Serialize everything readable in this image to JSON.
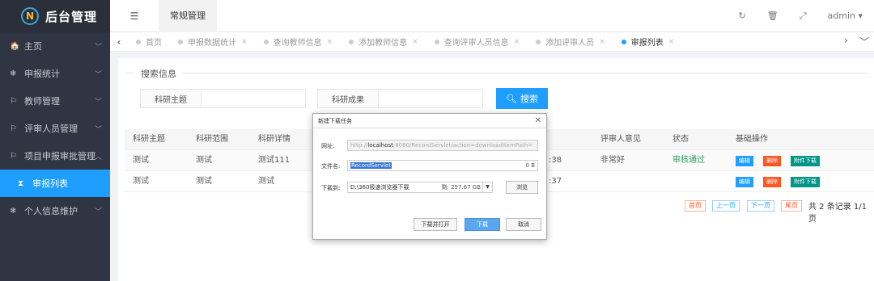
{
  "sidebar": {
    "logo_text": "后台管理",
    "logo_mark": "N",
    "items": [
      {
        "label": "主页",
        "icon": "home-icon",
        "glyph": "🏠"
      },
      {
        "label": "申报统计",
        "icon": "snowflake-icon",
        "glyph": "❄"
      },
      {
        "label": "教师管理",
        "icon": "flag-icon",
        "glyph": "⚐"
      },
      {
        "label": "评审人员管理",
        "icon": "flag-icon",
        "glyph": "⚐"
      },
      {
        "label": "项目申报审批管理",
        "icon": "flag-icon",
        "glyph": "⚐"
      },
      {
        "label": "审报列表",
        "icon": "hourglass-icon",
        "glyph": "⧗"
      },
      {
        "label": "个人信息维护",
        "icon": "snowflake-icon",
        "glyph": "❄"
      }
    ]
  },
  "topbar": {
    "menu_icon": "☰",
    "tab_label": "常规管理",
    "user": "admin",
    "icons": [
      "refresh-icon",
      "trash-icon",
      "fullscreen-icon"
    ]
  },
  "tabstrip": {
    "tabs": [
      {
        "label": "首页"
      },
      {
        "label": "申报数据统计"
      },
      {
        "label": "查询教师信息"
      },
      {
        "label": "添加教师信息"
      },
      {
        "label": "查询评审人员信息"
      },
      {
        "label": "添加评审人员"
      },
      {
        "label": "审报列表"
      }
    ],
    "close_glyph": "×"
  },
  "search": {
    "legend": "搜索信息",
    "field1_label": "科研主题",
    "field2_label": "科研成果",
    "button_label": "搜索"
  },
  "table": {
    "headers": [
      "科研主题",
      "科研范围",
      "科研详情",
      "",
      "评审人意见",
      "状态",
      "基础操作"
    ],
    "rows": [
      {
        "topic": "测试",
        "scope": "测试",
        "detail": "测试111",
        "time": ":38",
        "opinion": "非常好",
        "status": "审核通过"
      },
      {
        "topic": "测试",
        "scope": "测试",
        "detail": "测试",
        "time": ":37",
        "opinion": "",
        "status": ""
      }
    ],
    "ops": {
      "edit": "编辑",
      "delete": "删除",
      "download": "附件下载"
    }
  },
  "pager": {
    "first": "首页",
    "prev": "上一页",
    "next": "下一页",
    "last": "尾页",
    "info": "共 2 条记录 1/1 页"
  },
  "dialog": {
    "title": "新建下载任务",
    "url_label": "网址:",
    "url_prefix": "http://",
    "url_host": "localhost",
    "url_rest": ":8080/RecordServlet/action=downloadItemPath=",
    "filename_label": "文件名:",
    "filename_value": "RecordServlet",
    "filename_size": "0 B",
    "dir_label": "下载到:",
    "dir_value": "D:\\360极速浏览器下载",
    "dir_free": "剩: 257.67 GB",
    "browse_label": "浏览",
    "btn_open": "下载并打开",
    "btn_download": "下载",
    "btn_cancel": "取消"
  }
}
